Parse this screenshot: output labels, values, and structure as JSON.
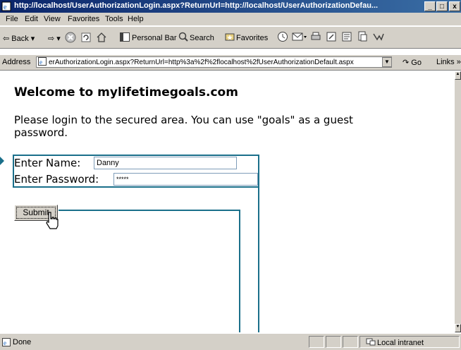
{
  "window": {
    "title": "http://localhost/UserAuthorizationLogin.aspx?ReturnUrl=http://localhost/UserAuthorizationDefau...",
    "controls": [
      "_",
      "□",
      "x"
    ]
  },
  "menu": [
    "File",
    "Edit",
    "View",
    "Favorites",
    "Tools",
    "Help"
  ],
  "toolbar": {
    "back": "⇦ Back ▾",
    "forward": "⇨ ▾",
    "personal_bar": "Personal Bar",
    "search": "Search",
    "favorites": "Favorites"
  },
  "address": {
    "label": "Address",
    "value": "erAuthorizationLogin.aspx?ReturnUrl=http%3a%2f%2flocalhost%2fUserAuthorizationDefault.aspx",
    "go": "Go",
    "links": "Links »"
  },
  "page": {
    "heading": "Welcome to mylifetimegoals.com",
    "intro": "Please login to the secured area. You can use \"goals\" as a guest password.",
    "name_label": "Enter Name:",
    "name_value": "Danny",
    "password_label": "Enter Password:",
    "password_value": "*****",
    "submit_label": "Submit"
  },
  "status": {
    "text": "Done",
    "zone": "Local intranet"
  },
  "colors": {
    "titlebar_start": "#0a246a",
    "titlebar_end": "#3a6ea5",
    "chrome": "#d4d0c8",
    "callout": "#1a6f8a"
  }
}
